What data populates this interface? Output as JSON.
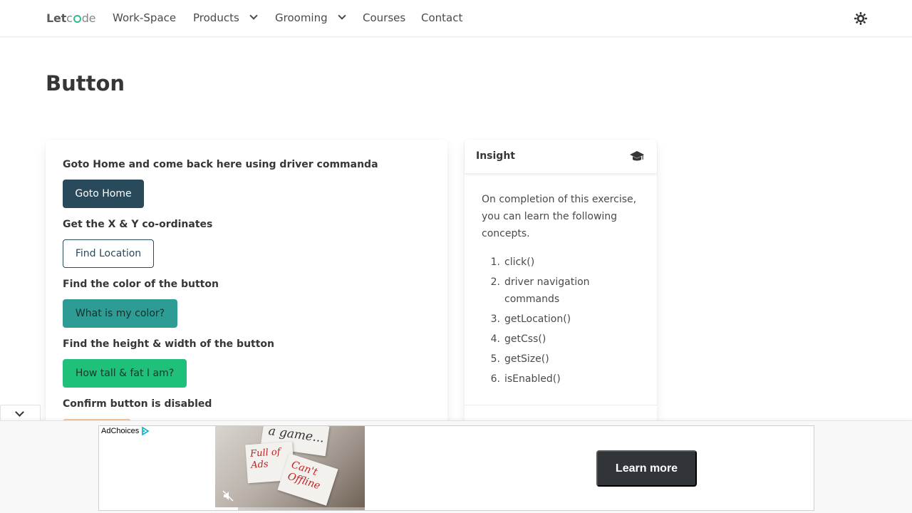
{
  "navbar": {
    "logo": {
      "part1": "Let",
      "part2": "c",
      "part3": "de"
    },
    "items": [
      {
        "label": "Work-Space"
      },
      {
        "label": "Products",
        "has_dropdown": true
      },
      {
        "label": "Grooming",
        "has_dropdown": true
      },
      {
        "label": "Courses"
      },
      {
        "label": "Contact"
      }
    ],
    "theme_toggle_icon": "sun-gear-icon"
  },
  "page": {
    "title": "Button"
  },
  "exercises": [
    {
      "label": "Goto Home and come back here using driver commanda",
      "button": "Goto Home"
    },
    {
      "label": "Get the X & Y co-ordinates",
      "button": "Find Location"
    },
    {
      "label": "Find the color of the button",
      "button": "What is my color?"
    },
    {
      "label": "Find the height & width of the button",
      "button": "How tall & fat I am?"
    },
    {
      "label": "Confirm button is disabled",
      "button": ""
    }
  ],
  "insight": {
    "title": "Insight",
    "icon": "graduation-cap-icon",
    "intro": "On completion of this exercise, you can learn the following concepts.",
    "concepts": [
      {
        "num": "1.",
        "text": "click()"
      },
      {
        "num": "2.",
        "text": "driver navigation commands"
      },
      {
        "num": "3.",
        "text": "getLocation()"
      },
      {
        "num": "4.",
        "text": "getCss()"
      },
      {
        "num": "5.",
        "text": "getSize()"
      },
      {
        "num": "6.",
        "text": "isEnabled()"
      }
    ]
  },
  "ad": {
    "adchoices": "AdChoices",
    "notes": {
      "n1": "a game...",
      "n2a": "Full of",
      "n2b": "Ads",
      "n3a": "Can't",
      "n3b": "Offline"
    },
    "cta": "Learn more",
    "progress": 0.15
  },
  "colors": {
    "dark_button": "#294a5a",
    "teal_button": "#2c9c94",
    "green_button": "#1ec07a",
    "orange_button": "#f7c79a",
    "logo_accent": "#2bbf8e"
  }
}
